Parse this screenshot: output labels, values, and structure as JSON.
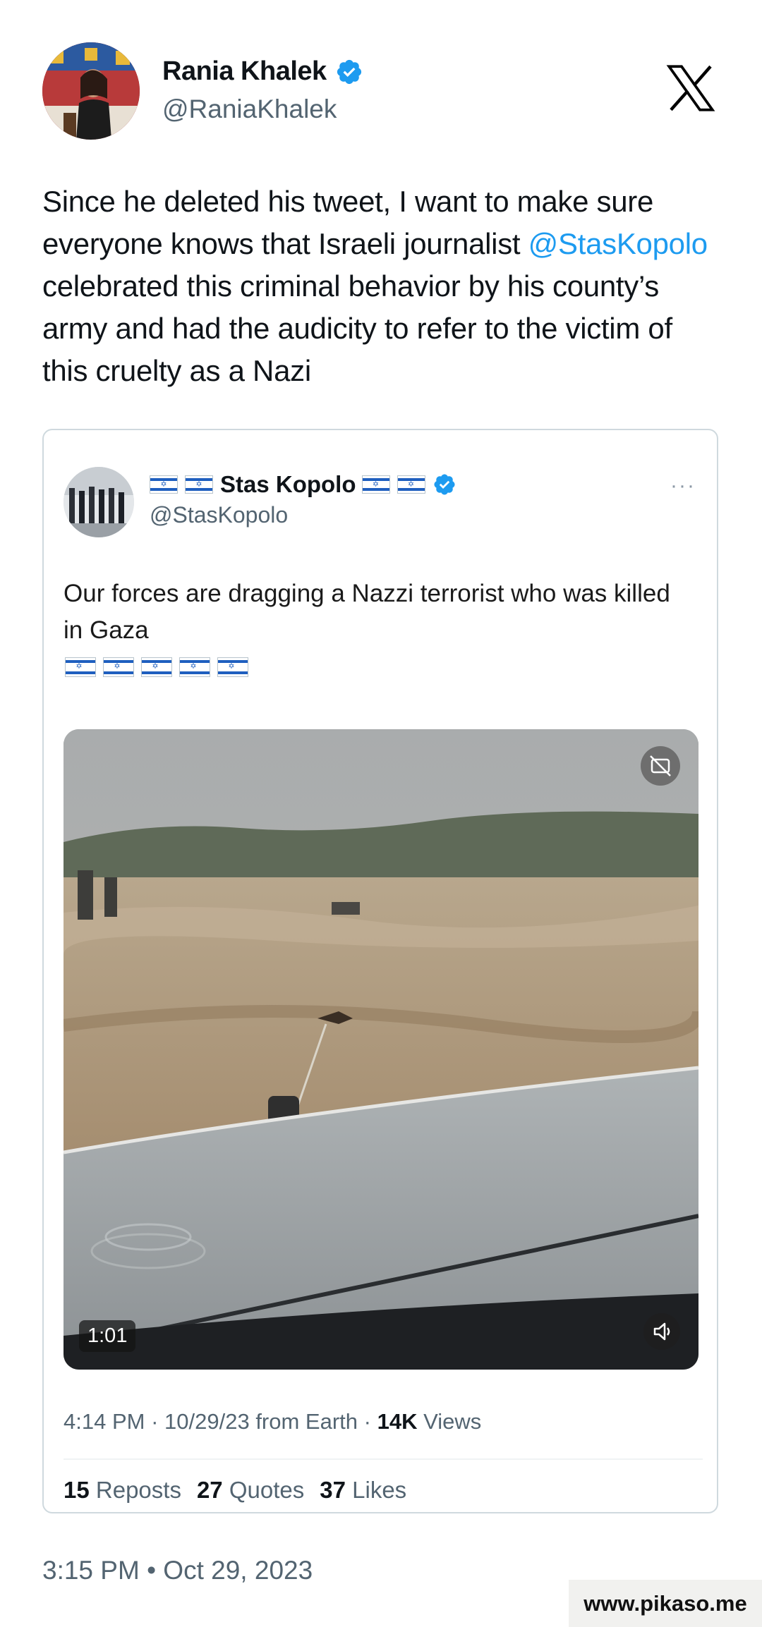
{
  "author": {
    "name": "Rania Khalek",
    "handle": "@RaniaKhalek",
    "verified": true
  },
  "brand": "X-logo",
  "tweet": {
    "text_before": "Since he deleted his tweet, I want to make sure everyone knows that Israeli journalist ",
    "mention": "@StasKopolo",
    "text_after": " celebrated this criminal behavior by his county’s army and had the audicity to refer to the victim of this cruelty as a Nazi"
  },
  "quoted": {
    "name": "Stas Kopolo",
    "handle": "@StasKopolo",
    "verified": true,
    "more": "···",
    "text": "Our forces are dragging a Nazzi terrorist who was killed in Gaza",
    "flag_count": 5,
    "video": {
      "duration": "1:01"
    },
    "meta": {
      "time": "4:14 PM",
      "date": "10/29/23",
      "source": "from Earth",
      "views": "14K",
      "views_label": "Views"
    },
    "stats": {
      "reposts": "15",
      "reposts_label": "Reposts",
      "quotes": "27",
      "quotes_label": "Quotes",
      "likes": "37",
      "likes_label": "Likes"
    }
  },
  "timestamp": "3:15 PM • Oct 29, 2023",
  "watermark": "www.pikaso.me",
  "colors": {
    "link": "#1d9bf0",
    "secondary_text": "#536471",
    "verified": "#1d9bf0"
  }
}
